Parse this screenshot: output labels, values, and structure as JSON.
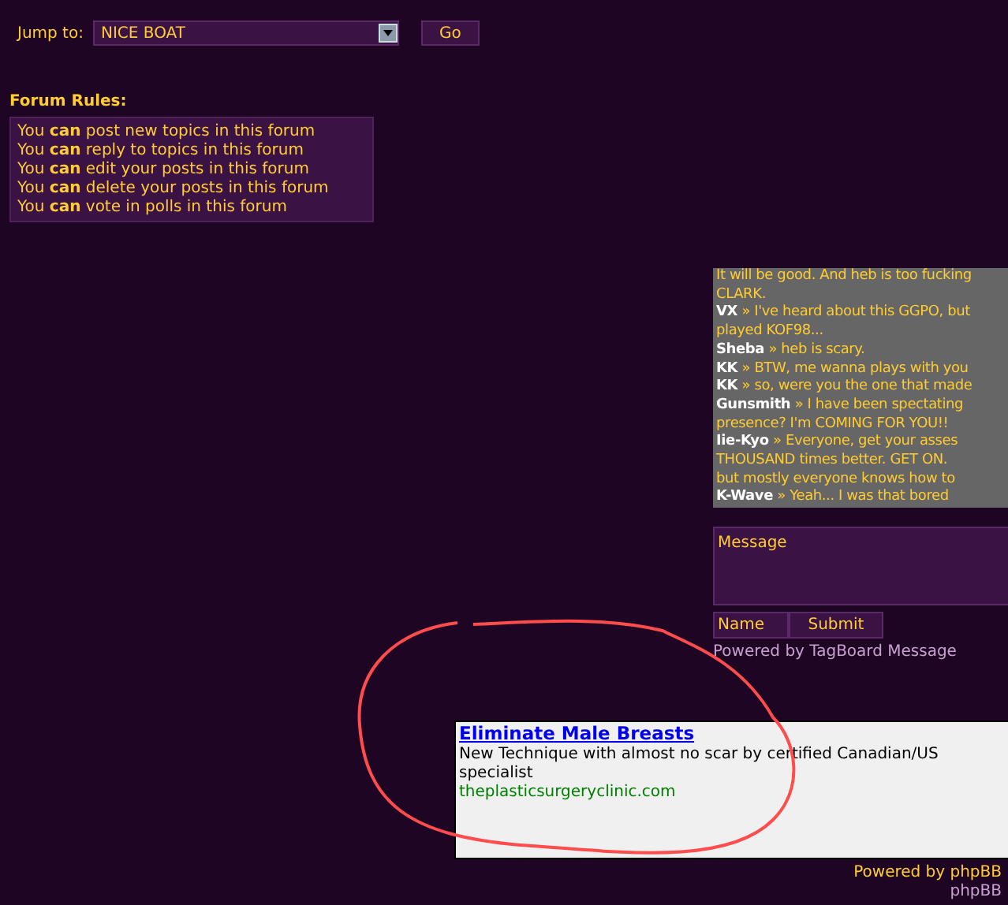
{
  "jump": {
    "label": "Jump to:",
    "value": "NICE BOAT",
    "button": "Go"
  },
  "forum_rules": {
    "title": "Forum Rules:",
    "rules": [
      {
        "text": "You **can** post new topics in this forum"
      },
      {
        "text": "You **can** reply to topics in this forum"
      },
      {
        "text": "You **can** edit your posts in this forum"
      },
      {
        "text": "You **can** delete your posts in this forum"
      },
      {
        "text": "You **can** vote in polls in this forum"
      }
    ]
  },
  "tagboard": {
    "lines": [
      {
        "kind": "continuation",
        "text": "It will be good. And heb is too fucking"
      },
      {
        "kind": "continuation",
        "text": "CLARK."
      },
      {
        "kind": "post",
        "name": "VX",
        "text": "» I've heard about this GGPO, but"
      },
      {
        "kind": "continuation",
        "text": "played KOF98..."
      },
      {
        "kind": "post",
        "name": "Sheba",
        "text": "» heb is scary."
      },
      {
        "kind": "post",
        "name": "KK",
        "text": "» BTW, me wanna plays with you"
      },
      {
        "kind": "post",
        "name": "KK",
        "text": "» so, were you the one that made"
      },
      {
        "kind": "post",
        "name": "Gunsmith",
        "text": "» I have been spectating"
      },
      {
        "kind": "continuation",
        "text": "presence? I'm COMING FOR YOU!!"
      },
      {
        "kind": "post",
        "name": "Iie-Kyo",
        "text": "» Everyone, get your asses"
      },
      {
        "kind": "continuation",
        "text": "THOUSAND times better. GET ON."
      },
      {
        "kind": "continuation",
        "text": "but mostly everyone knows how to"
      },
      {
        "kind": "post",
        "name": "K-Wave",
        "text": "» Yeah... I was that bored"
      }
    ],
    "message_placeholder": "Message",
    "name_placeholder": "Name",
    "submit": "Submit",
    "powered": "Powered by TagBoard Message"
  },
  "ad": {
    "title": "Eliminate Male Breasts",
    "text": "New Technique with almost no scar by certified Canadian/US specialist",
    "url": "theplasticsurgeryclinic.com"
  },
  "footer": {
    "powered": "Powered by phpBB",
    "template": "phpBB"
  }
}
